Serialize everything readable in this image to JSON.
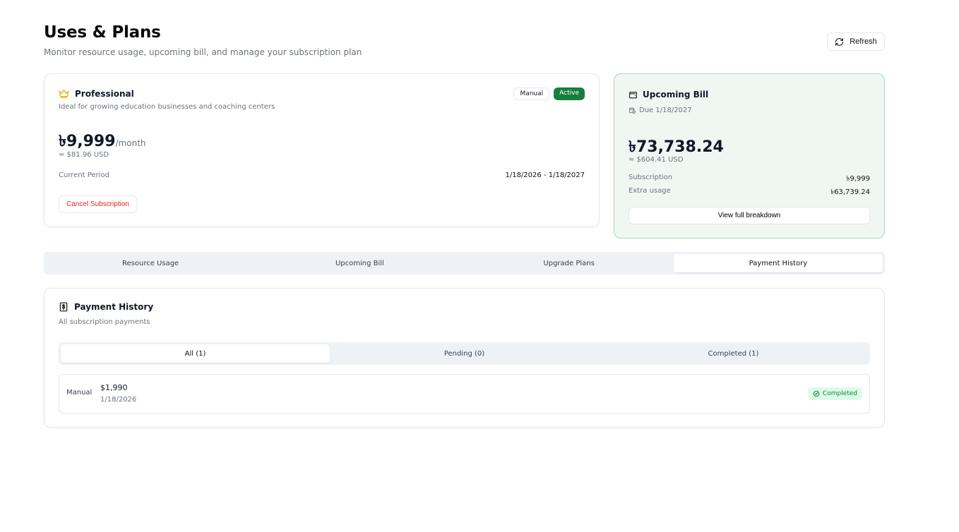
{
  "header": {
    "title": "Uses & Plans",
    "subtitle": "Monitor resource usage, upcoming bill, and manage your subscription plan",
    "refresh_label": "Refresh"
  },
  "plan": {
    "name": "Professional",
    "description": "Ideal for growing education businesses and coaching centers",
    "badge_manual": "Manual",
    "badge_active": "Active",
    "price": "৳9,999",
    "per": "/month",
    "usd": "≈ $81.96 USD",
    "period_label": "Current Period",
    "period_value": "1/18/2026 - 1/18/2027",
    "cancel_label": "Cancel Subscription"
  },
  "bill": {
    "title": "Upcoming Bill",
    "due": "Due 1/18/2027",
    "amount": "৳73,738.24",
    "usd": "≈ $604.41 USD",
    "rows": [
      {
        "label": "Subscription",
        "value": "৳9,999"
      },
      {
        "label": "Extra usage",
        "value": "৳63,739.24"
      }
    ],
    "breakdown_label": "View full breakdown"
  },
  "tabs": [
    {
      "label": "Resource Usage"
    },
    {
      "label": "Upcoming Bill"
    },
    {
      "label": "Upgrade Plans"
    },
    {
      "label": "Payment History"
    }
  ],
  "history": {
    "title": "Payment History",
    "subtitle": "All subscription payments",
    "filters": [
      {
        "label": "All (1)"
      },
      {
        "label": "Pending (0)"
      },
      {
        "label": "Completed (1)"
      }
    ],
    "payments": [
      {
        "method": "Manual",
        "amount": "$1,990",
        "date": "1/18/2026",
        "status": "Completed"
      }
    ]
  },
  "colors": {
    "accent_green": "#15803d",
    "danger": "#dc2626",
    "crown": "#eab308"
  }
}
